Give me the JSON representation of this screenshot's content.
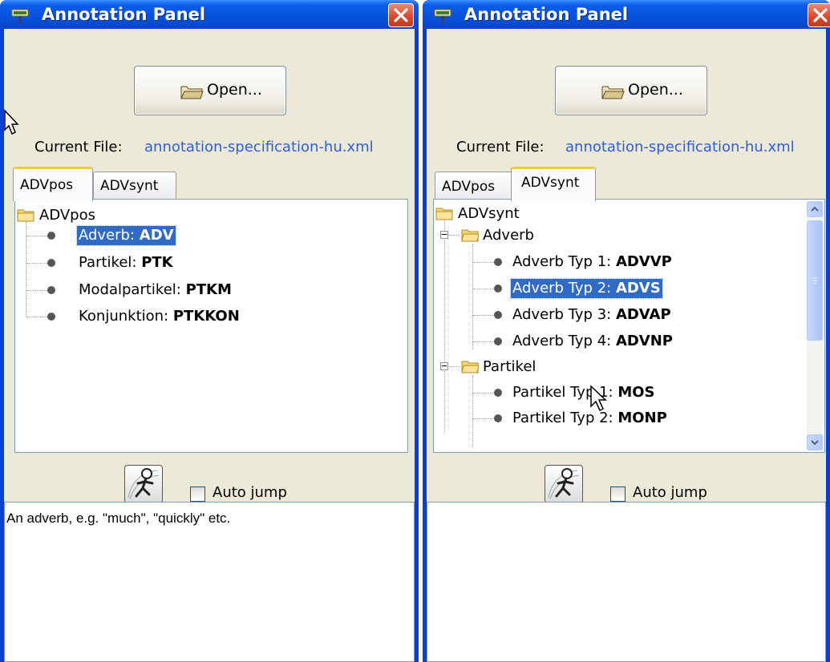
{
  "panels": [
    {
      "title": "Annotation Panel",
      "open_button_label": "Open...",
      "current_file_label": "Current File:",
      "current_file_value": "annotation-specification-hu.xml",
      "tabs": [
        {
          "label": "ADVpos",
          "active": true
        },
        {
          "label": "ADVsynt",
          "active": false
        }
      ],
      "tree": {
        "root": "ADVpos",
        "items": [
          {
            "text": "Adverb: ",
            "code": "ADV",
            "selected": true
          },
          {
            "text": "Partikel: ",
            "code": "PTK"
          },
          {
            "text": "Modalpartikel: ",
            "code": "PTKM"
          },
          {
            "text": "Konjunktion: ",
            "code": "PTKKON"
          }
        ]
      },
      "auto_jump_label": "Auto jump",
      "description": "An adverb, e.g. \"much\", \"quickly\" etc."
    },
    {
      "title": "Annotation Panel",
      "open_button_label": "Open...",
      "current_file_label": "Current File:",
      "current_file_value": "annotation-specification-hu.xml",
      "tabs": [
        {
          "label": "ADVpos",
          "active": false
        },
        {
          "label": "ADVsynt",
          "active": true
        }
      ],
      "tree": {
        "root": "ADVsynt",
        "groups": [
          {
            "label": "Adverb",
            "items": [
              {
                "text": "Adverb Typ 1: ",
                "code": "ADVVP"
              },
              {
                "text": "Adverb Typ 2: ",
                "code": "ADVS",
                "selected": true
              },
              {
                "text": "Adverb Typ 3: ",
                "code": "ADVAP"
              },
              {
                "text": "Adverb Typ 4: ",
                "code": "ADVNP"
              }
            ]
          },
          {
            "label": "Partikel",
            "items": [
              {
                "text": "Partikel Typ 1: ",
                "code": "MOS"
              },
              {
                "text": "Partikel Typ 2: ",
                "code": "MONP"
              }
            ]
          }
        ]
      },
      "auto_jump_label": "Auto jump",
      "description": ""
    }
  ],
  "colors": {
    "title_bar": "#0752db",
    "selection": "#316ac5",
    "file_link": "#2e5ed8",
    "window_body": "#ece9d8",
    "close_button": "#d8472a"
  }
}
